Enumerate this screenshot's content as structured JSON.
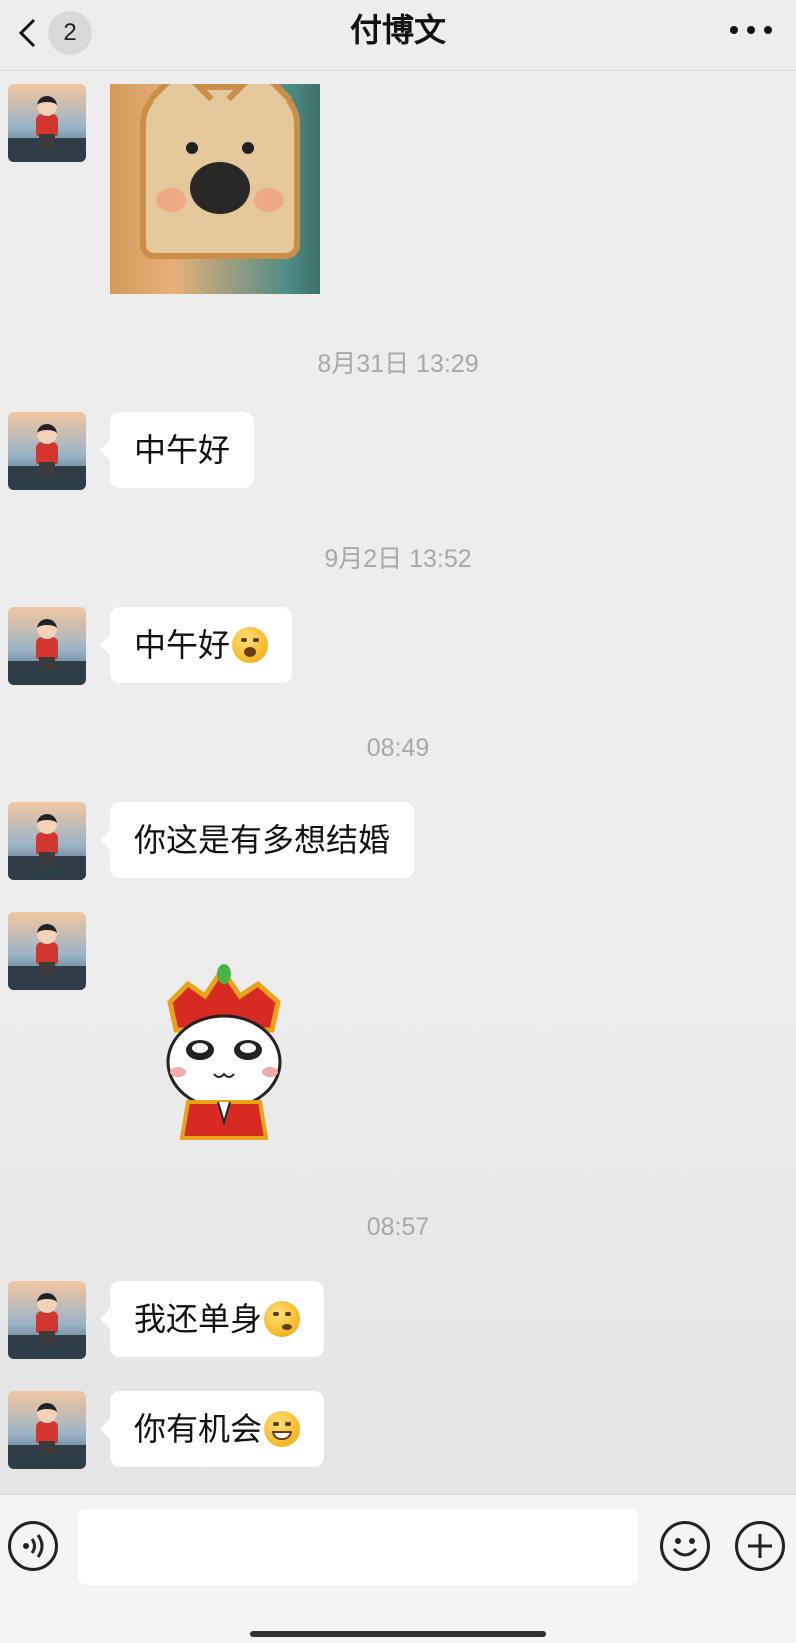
{
  "header": {
    "back_badge": "2",
    "title": "付博文",
    "more_icon": "more-dots-icon"
  },
  "messages": [
    {
      "type": "image",
      "description_icon": "bread-dog-photo"
    },
    {
      "timestamp": "8月31日 13:29",
      "text": "中午好"
    },
    {
      "timestamp": "9月2日 13:52",
      "text": "中午好",
      "emoji": "surprised-face"
    },
    {
      "timestamp": "08:49",
      "text": "你这是有多想结婚"
    },
    {
      "type": "sticker",
      "description_icon": "crowned-bowing-sticker"
    },
    {
      "timestamp": "08:57",
      "text": "我还单身",
      "emoji": "thinking-face"
    },
    {
      "text": "你有机会",
      "emoji": "grinning-face"
    }
  ],
  "input_bar": {
    "voice_icon": "voice-icon",
    "emoji_icon": "emoji-icon",
    "plus_icon": "plus-icon",
    "text_value": ""
  },
  "colors": {
    "background": "#ededed",
    "bubble": "#ffffff",
    "timestamp": "#a8a8a8"
  }
}
